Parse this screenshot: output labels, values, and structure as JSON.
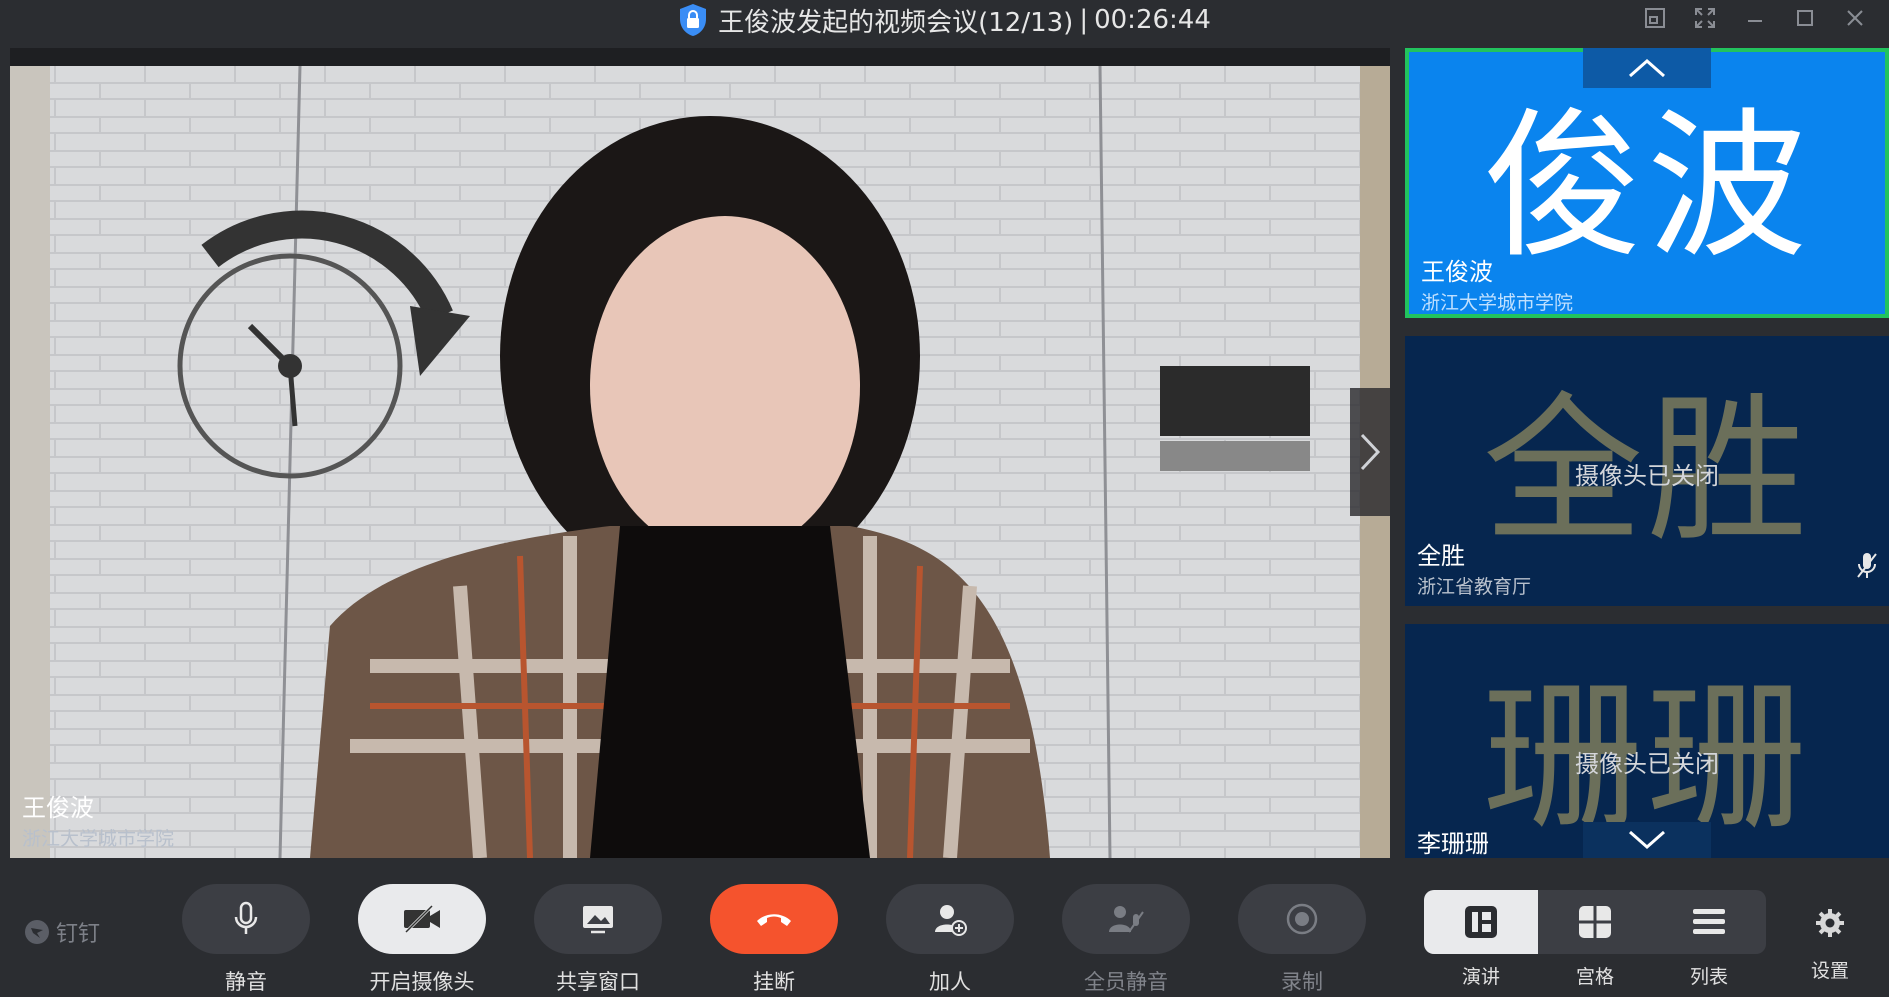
{
  "titlebar": {
    "title": "王俊波发起的视频会议(12/13)",
    "separator": "|",
    "timer": "00:26:44"
  },
  "main_video": {
    "name": "王俊波",
    "org": "浙江大学城市学院"
  },
  "participants": [
    {
      "big_name": "俊波",
      "name": "王俊波",
      "org": "浙江大学城市学院",
      "status": "",
      "active": true
    },
    {
      "big_name": "全胜",
      "name": "全胜",
      "org": "浙江省教育厅",
      "status": "摄像头已关闭",
      "active": false
    },
    {
      "big_name": "珊珊",
      "name": "李珊珊",
      "org": "",
      "status": "摄像头已关闭",
      "active": false
    }
  ],
  "toolbar": {
    "brand": "钉钉",
    "mute": "静音",
    "camera": "开启摄像头",
    "share": "共享窗口",
    "hangup": "挂断",
    "add": "加人",
    "mute_all": "全员静音",
    "record": "录制"
  },
  "layout": {
    "speaker": "演讲",
    "grid": "宫格",
    "list": "列表",
    "settings": "设置"
  },
  "colors": {
    "bg": "#2b2d31",
    "active_tile": "#0a84ee",
    "active_border": "#22c35e",
    "tile": "#06264f",
    "hangup": "#f5532d"
  }
}
